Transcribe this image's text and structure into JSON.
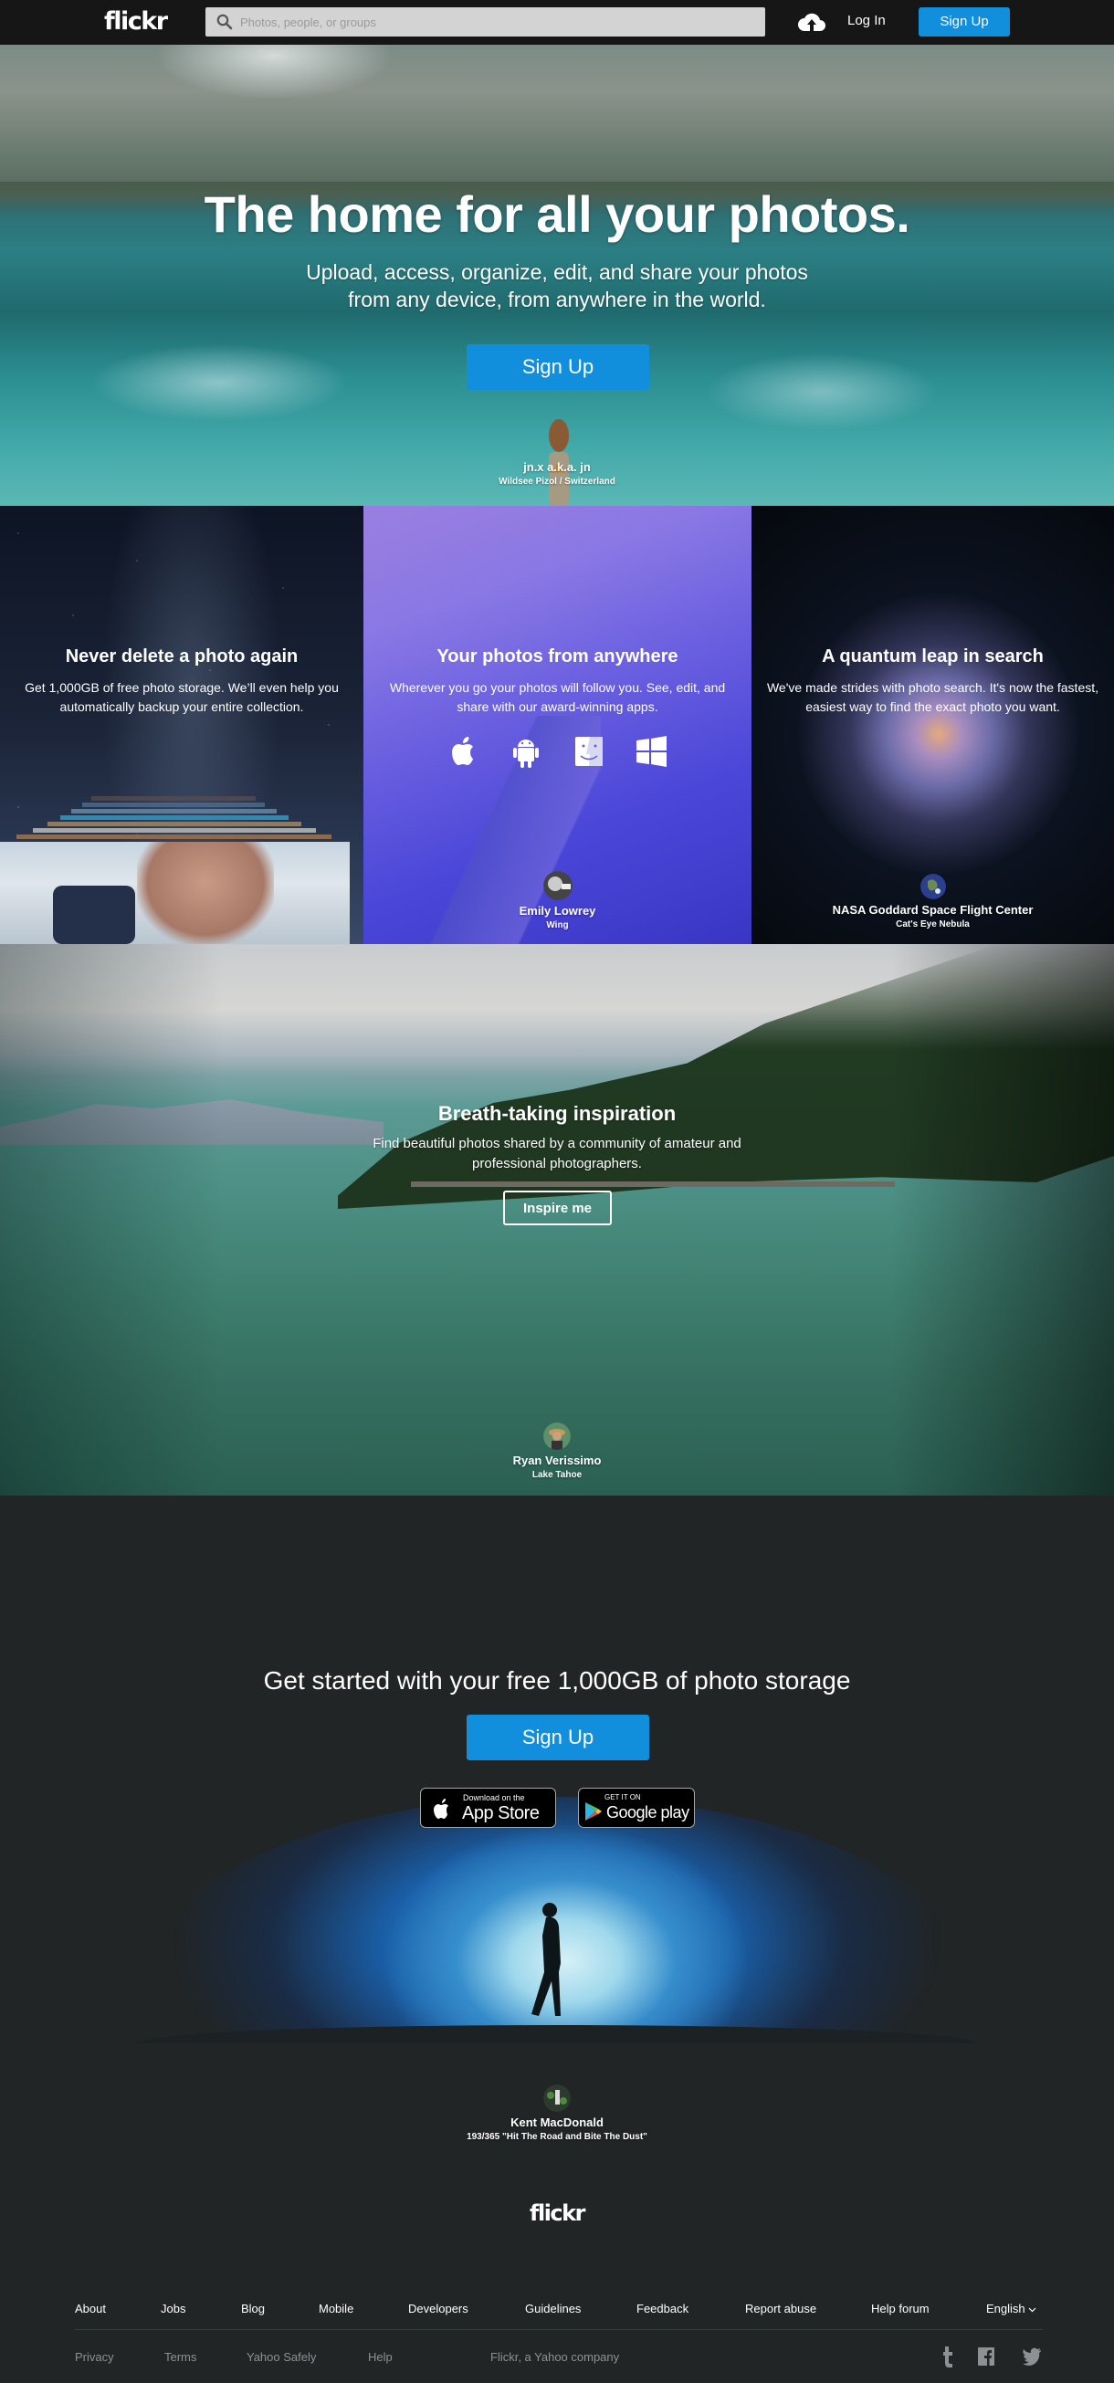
{
  "header": {
    "logo": "flickr",
    "search_placeholder": "Photos, people, or groups",
    "search_value": "",
    "upload_icon": "cloud-upload-icon",
    "login_label": "Log In",
    "signup_label": "Sign Up"
  },
  "hero": {
    "title": "The home for all your photos.",
    "subtitle": "Upload, access, organize, edit, and share your photos from any device, from anywhere in the world.",
    "cta_label": "Sign Up",
    "credit_name": "jn.x a.k.a. jn",
    "credit_title": "Wildsee Pizol / Switzerland"
  },
  "features": [
    {
      "title": "Never delete a photo again",
      "text": "Get 1,000GB of free photo storage. We’ll even help you automatically backup your entire collection."
    },
    {
      "title": "Your photos from anywhere",
      "text": "Wherever you go your photos will follow you. See, edit, and share with our award-winning apps.",
      "platform_icons": [
        "apple-icon",
        "android-icon",
        "mac-finder-icon",
        "windows-icon"
      ],
      "credit_name": "Emily Lowrey",
      "credit_title": "Wing"
    },
    {
      "title": "A quantum leap in search",
      "text": "We've made strides with photo search. It's now the fastest, easiest way to find the exact photo you want.",
      "credit_name": "NASA Goddard Space Flight Center",
      "credit_title": "Cat's Eye Nebula"
    }
  ],
  "inspiration": {
    "title": "Breath-taking inspiration",
    "text": "Find beautiful photos shared by a community of amateur and professional photographers.",
    "button_label": "Inspire me",
    "credit_name": "Ryan Verissimo",
    "credit_title": "Lake Tahoe"
  },
  "get_started": {
    "title": "Get started with your free 1,000GB of photo storage",
    "cta_label": "Sign Up",
    "app_store": {
      "small": "Download on the",
      "large": "App Store"
    },
    "google_play": {
      "small": "GET IT ON",
      "large": "Google play"
    },
    "credit_name": "Kent MacDonald",
    "credit_title": "193/365 \"Hit The Road and Bite The Dust\""
  },
  "footer": {
    "logo": "flickr",
    "nav": [
      "About",
      "Jobs",
      "Blog",
      "Mobile",
      "Developers",
      "Guidelines",
      "Feedback",
      "Report abuse",
      "Help forum"
    ],
    "language": "English",
    "legal": [
      "Privacy",
      "Terms",
      "Yahoo Safely",
      "Help"
    ],
    "company": "Flickr, a Yahoo company",
    "social_icons": [
      "tumblr-icon",
      "facebook-icon",
      "twitter-icon"
    ]
  },
  "colors": {
    "brand_blue": "#128fdc",
    "header_bg": "#161617",
    "footer_bg": "#212526"
  }
}
